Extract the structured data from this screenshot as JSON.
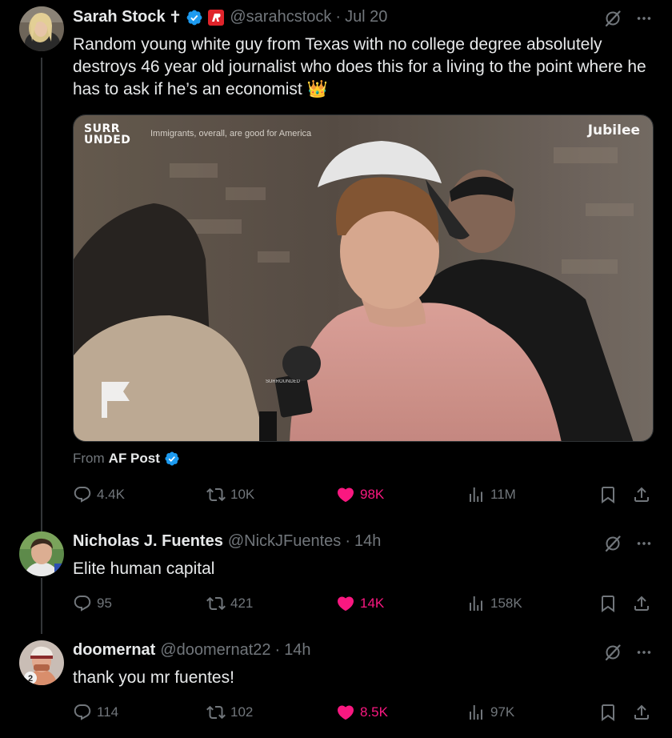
{
  "thread": {
    "main_post": {
      "author_name": "Sarah Stock",
      "name_symbol": "✝",
      "handle": "@sarahcstock",
      "date": "Jul 20",
      "text": "Random young white guy from Texas with no college degree absolutely destroys 46 year old journalist who does this for a living to the point where he has to ask if he’s an economist 👑",
      "media": {
        "logo_line1": "SURR",
        "logo_line2": "UNDED",
        "caption": "Immigrants, overall, are good for America",
        "brand": "Jubilee",
        "mic_label": "SURROUNDED"
      },
      "from_prefix": "From",
      "from_account": "AF Post",
      "stats": {
        "replies": "4.4K",
        "reposts": "10K",
        "likes": "98K",
        "views": "11M"
      }
    },
    "replies": [
      {
        "author_name": "Nicholas J. Fuentes",
        "handle": "@NickJFuentes",
        "date": "14h",
        "text": "Elite human capital",
        "stats": {
          "replies": "95",
          "reposts": "421",
          "likes": "14K",
          "views": "158K"
        }
      },
      {
        "author_name": "doomernat",
        "handle": "@doomernat22",
        "date": "14h",
        "text": "thank you mr fuentes!",
        "avatar_badge": "2",
        "stats": {
          "replies": "114",
          "reposts": "102",
          "likes": "8.5K",
          "views": "97K"
        }
      }
    ]
  },
  "colors": {
    "background": "#000000",
    "text": "#e7e9ea",
    "muted": "#71767b",
    "like_pink": "#f91880",
    "verified_blue": "#1d9bf0",
    "thread_line": "#333639"
  },
  "icons": {
    "reply": "reply-icon",
    "repost": "repost-icon",
    "like": "heart-icon",
    "views": "views-icon",
    "bookmark": "bookmark-icon",
    "share": "share-icon",
    "grok": "grok-icon",
    "more": "more-icon",
    "verified": "verified-badge-icon"
  }
}
